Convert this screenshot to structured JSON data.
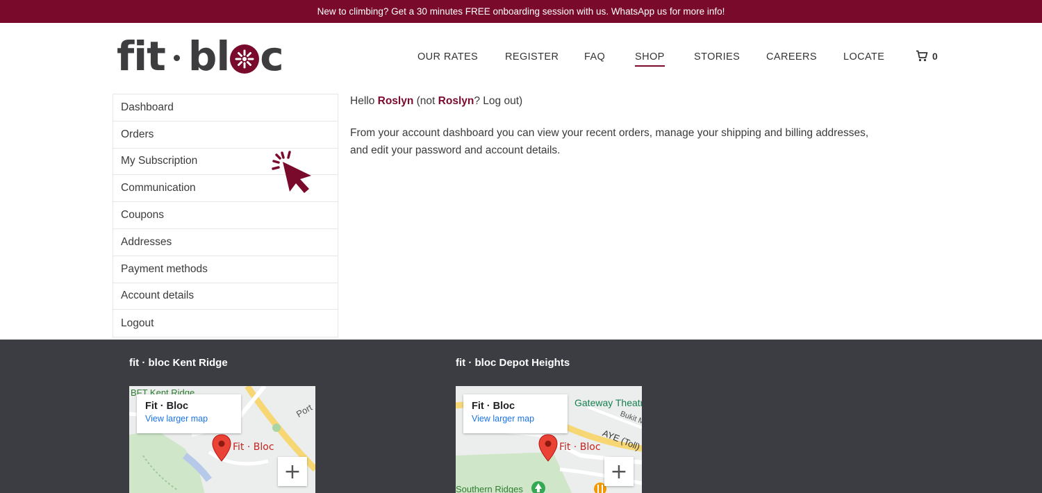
{
  "announcement": "New to climbing? Get a 30 minutes FREE onboarding session with us. WhatsApp us for more info!",
  "logo": {
    "part1": "fit",
    "part2": "bl",
    "part3": "c"
  },
  "nav": {
    "items": [
      {
        "label": "OUR RATES"
      },
      {
        "label": "REGISTER"
      },
      {
        "label": "FAQ"
      },
      {
        "label": "SHOP"
      },
      {
        "label": "STORIES"
      },
      {
        "label": "CAREERS"
      },
      {
        "label": "LOCATE"
      }
    ],
    "cart_count": "0"
  },
  "account_menu": [
    "Dashboard",
    "Orders",
    "My Subscription",
    "Communication",
    "Coupons",
    "Addresses",
    "Payment methods",
    "Account details",
    "Logout"
  ],
  "dashboard": {
    "hello_prefix": "Hello",
    "user": "Roslyn",
    "not_prefix": "(not",
    "logout_suffix": "? Log out)",
    "description": "From your account dashboard you can view your recent orders, manage your shipping and billing addresses, and edit your password and account details."
  },
  "locations": [
    {
      "title": "fit · bloc Kent Ridge",
      "map_card_title": "Fit · Bloc",
      "map_card_link": "View larger map",
      "pin_label": "Fit · Bloc",
      "streets": [
        "BFT Kent Ridge",
        "Port"
      ]
    },
    {
      "title": "fit · bloc Depot Heights",
      "map_card_title": "Fit · Bloc",
      "map_card_link": "View larger map",
      "pin_label": "Fit · Bloc",
      "streets": [
        "Gateway Theatre",
        "Bukit M",
        "AYE (Toll)",
        "Southern Ridges"
      ]
    }
  ],
  "zoom_label": "+",
  "colors": {
    "brand": "#7a0a2c",
    "footer": "#3c3d42",
    "link": "#1a73e8"
  }
}
